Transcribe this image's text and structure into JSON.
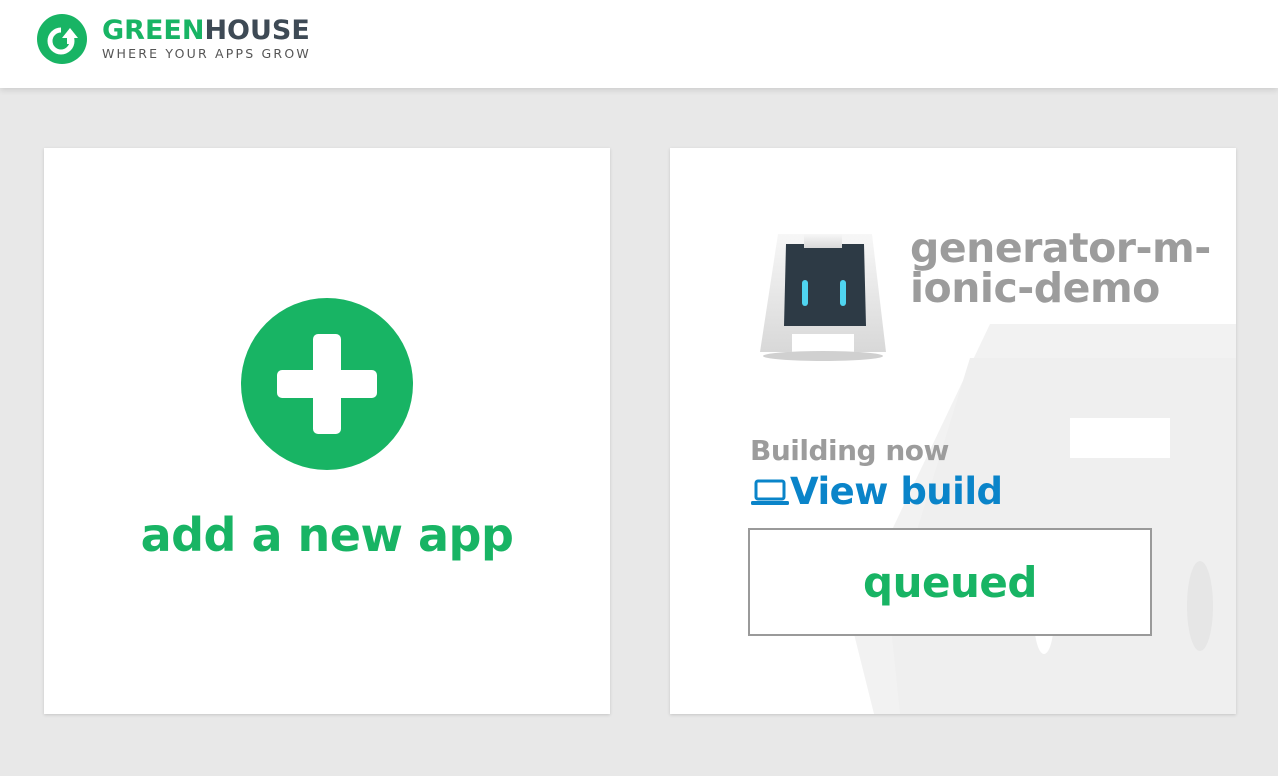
{
  "header": {
    "brand_part1": "GREEN",
    "brand_part2": "HOUSE",
    "tagline": "WHERE YOUR APPS GROW",
    "logo_icon": "greenhouse-logo-icon"
  },
  "cards": {
    "add_app": {
      "label": "add a new app",
      "icon": "plus-circle-icon"
    },
    "app": {
      "name": "generator-m-ionic-demo",
      "icon": "cordova-icon",
      "status_text": "Building now",
      "view_build_label": "View build",
      "view_build_icon": "laptop-icon",
      "build_state": "queued"
    }
  },
  "colors": {
    "brand_green": "#18b464",
    "link_blue": "#0a84c9",
    "muted_gray": "#9c9c9c",
    "background": "#e8e8e8"
  }
}
